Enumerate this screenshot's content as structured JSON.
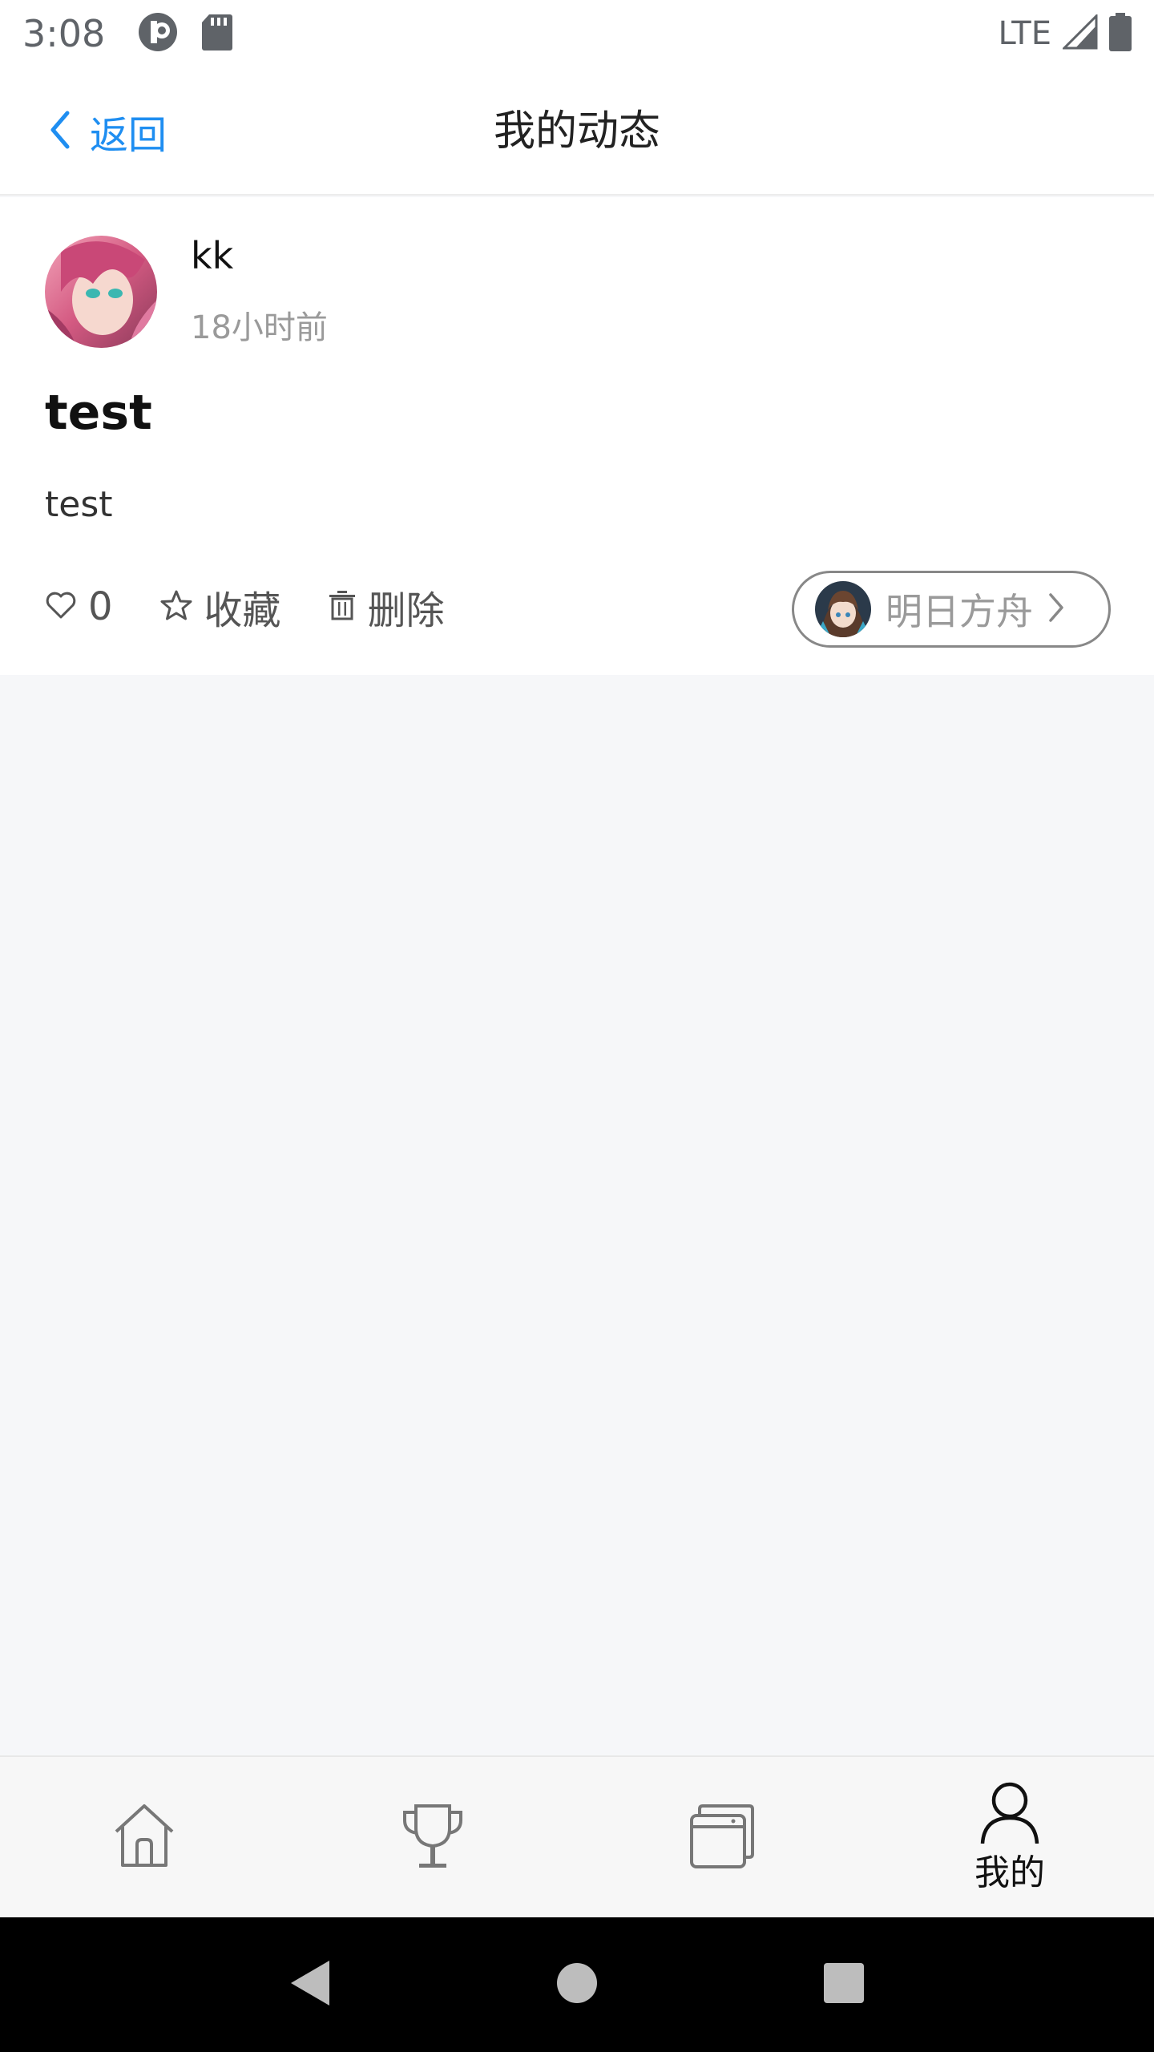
{
  "status_bar": {
    "time": "3:08",
    "network": "LTE",
    "icons": [
      "notification-app-icon",
      "sd-card-icon",
      "signal-icon",
      "battery-icon"
    ]
  },
  "nav": {
    "back_label": "返回",
    "title": "我的动态"
  },
  "post": {
    "author": "kk",
    "time": "18小时前",
    "title": "test",
    "body": "test",
    "like_count": "0",
    "favorite_label": "收藏",
    "delete_label": "删除",
    "tag_label": "明日方舟"
  },
  "tab_bar": {
    "items": [
      {
        "icon": "home-icon",
        "label": ""
      },
      {
        "icon": "trophy-icon",
        "label": ""
      },
      {
        "icon": "cards-icon",
        "label": ""
      },
      {
        "icon": "user-icon",
        "label": "我的"
      }
    ]
  },
  "colors": {
    "accent": "#1f8ef1",
    "page_bg": "#f6f7f9",
    "muted_text": "#9a9a9a"
  }
}
